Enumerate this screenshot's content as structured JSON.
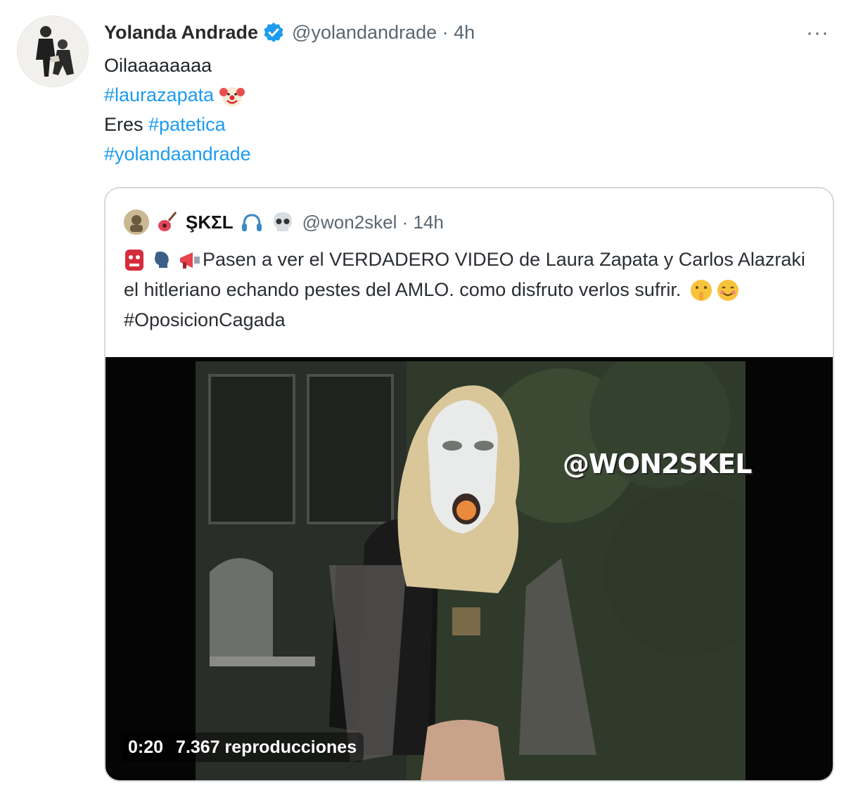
{
  "tweet": {
    "author_name": "Yolanda Andrade",
    "author_meta": "@yolandandrade · 4h",
    "lines": {
      "l1": "Oilaaaaaaaa",
      "l2_tag": "#laurazapata",
      "l3_prefix": "Eres ",
      "l3_tag": "#patetica",
      "l4_tag": "#yolandaandrade"
    },
    "more_label": "···"
  },
  "quoted": {
    "author_name": "ŞKΣL",
    "author_meta": "@won2skel · 14h",
    "text_main": "Pasen a ver el VERDADERO VIDEO de Laura Zapata y Carlos Alazraki  el hitleriano echando pestes del AMLO. como disfruto verlos sufrir. ",
    "text_tag": "#OposicionCagada",
    "video": {
      "duration": "0:20",
      "views": "7.367 reproducciones",
      "watermark": "@WON2SKEL"
    }
  },
  "colors": {
    "link": "#1d9bf0",
    "verified": "#1d9bf0",
    "muted": "#5b6670"
  },
  "icons": [
    "verified-badge-icon",
    "more-options-icon",
    "clown-emoji-icon",
    "skull-emoji-icon",
    "headphones-emoji-icon",
    "guitar-emoji-icon",
    "megaphone-emoji-icon",
    "speaking-head-emoji-icon",
    "shushing-face-emoji-icon",
    "smiling-face-emoji-icon"
  ]
}
